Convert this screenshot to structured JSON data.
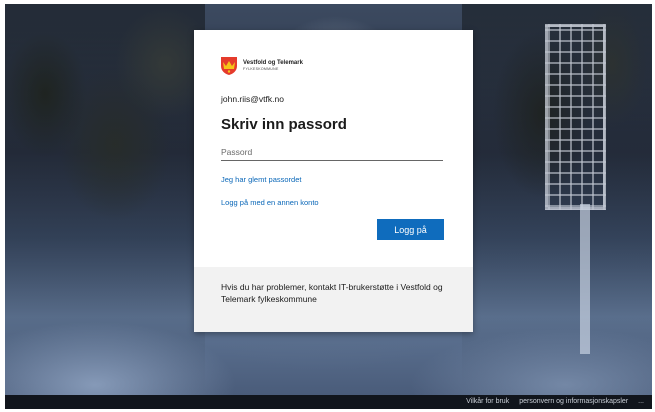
{
  "org": {
    "name": "Vestfold og Telemark",
    "sub": "FYLKESKOMMUNE",
    "logo_colors": [
      "#e53b2c",
      "#f5c518"
    ]
  },
  "signin": {
    "identity": "john.riis@vtfk.no",
    "heading": "Skriv inn passord",
    "password_placeholder": "Passord",
    "password_value": "",
    "forgot_link": "Jeg har glemt passordet",
    "other_account_link": "Logg på med en annen konto",
    "submit_label": "Logg på",
    "accent_color": "#0f6cbd"
  },
  "help": {
    "text": "Hvis du har problemer, kontakt IT-brukerstøtte i Vestfold og Telemark fylkeskommune"
  },
  "footer": {
    "terms": "Vilkår for bruk",
    "privacy": "personvern og informasjonskapsler",
    "more": "..."
  }
}
